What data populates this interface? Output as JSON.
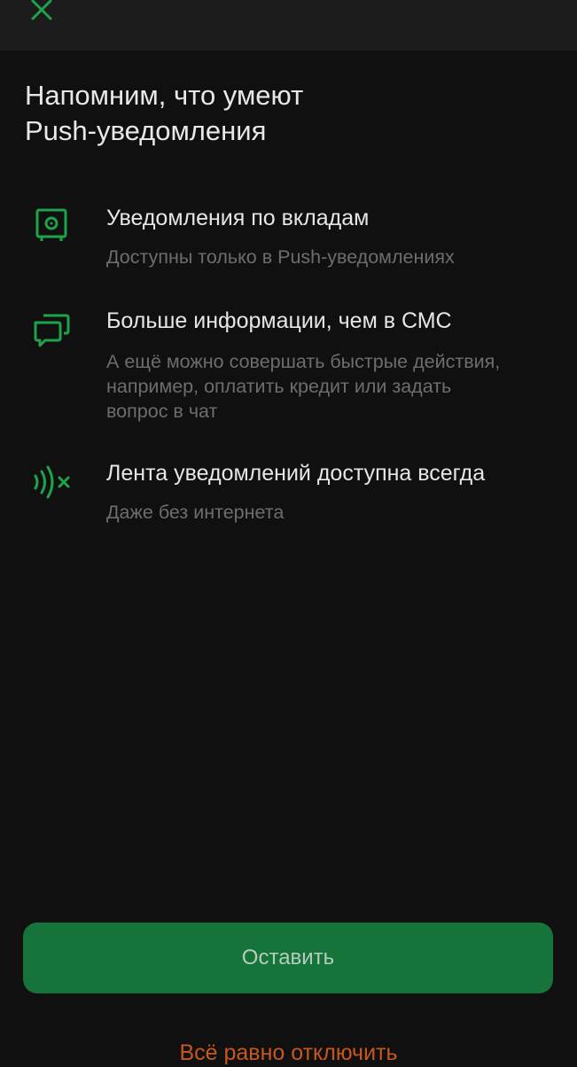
{
  "header": {
    "close_icon": "close-icon"
  },
  "title": {
    "line1": "Напомним, что умеют",
    "line2": "Push-уведомления"
  },
  "features": [
    {
      "icon": "safe-icon",
      "title": "Уведомления по вкладам",
      "description_lines": [
        "Доступны только в Push-уведомлениях"
      ]
    },
    {
      "icon": "chat-bubbles-icon",
      "title": "Больше информации, чем в СМС",
      "description_lines": [
        "А ещё можно совершать быстрые действия,",
        "например, оплатить кредит или задать",
        "вопрос в чат"
      ]
    },
    {
      "icon": "offline-signal-icon",
      "title": "Лента уведомлений доступна всегда",
      "description_lines": [
        "Даже без интернета"
      ]
    }
  ],
  "actions": {
    "keep_label": "Оставить",
    "disable_label": "Всё равно отключить"
  },
  "colors": {
    "background": "#101010",
    "accent_green": "#1ea24a",
    "button_green": "#16743a",
    "danger_orange": "#c7571f"
  }
}
